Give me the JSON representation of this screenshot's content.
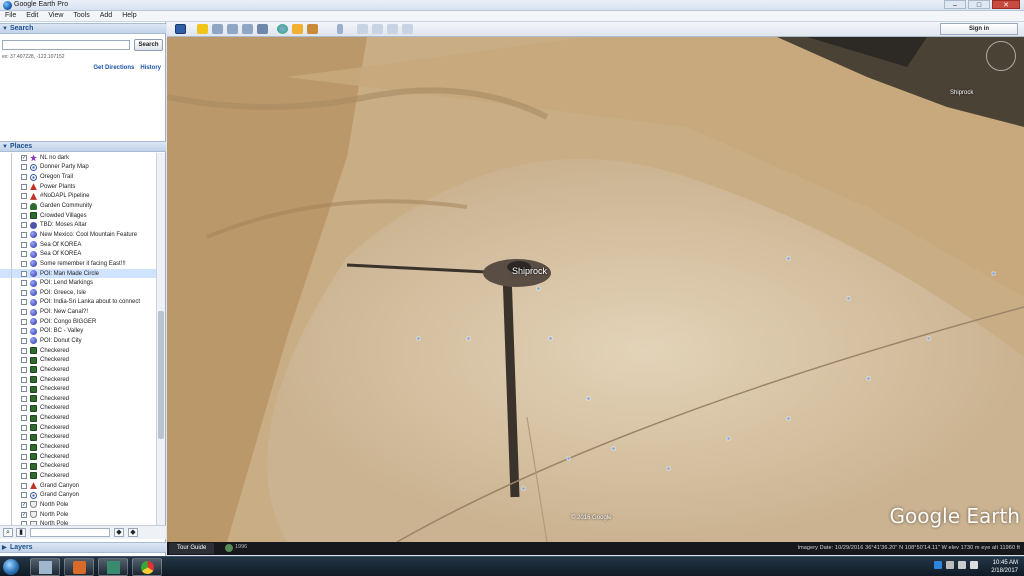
{
  "window": {
    "title": "Google Earth Pro"
  },
  "menu": [
    "File",
    "Edit",
    "View",
    "Tools",
    "Add",
    "Help"
  ],
  "search": {
    "header": "Search",
    "placeholder": "",
    "button": "Search",
    "coords": "ex: 37.407228, -122.107152",
    "get_directions": "Get Directions",
    "history": "History"
  },
  "places": {
    "header": "Places",
    "items": [
      {
        "label": "NL no dark",
        "icon": "star-icon",
        "checked": true
      },
      {
        "label": "Donner Party Map",
        "icon": "network-icon",
        "checked": false
      },
      {
        "label": "Oregon Trail",
        "icon": "network-icon",
        "checked": false
      },
      {
        "label": "Power Plants",
        "icon": "red-triangle-icon",
        "checked": false
      },
      {
        "label": "#NoDAPL Pipeline",
        "icon": "red-triangle-icon",
        "checked": false
      },
      {
        "label": "Garden Community",
        "icon": "tree-icon",
        "checked": false
      },
      {
        "label": "Crowded Villages",
        "icon": "green-square-icon",
        "checked": false
      },
      {
        "label": "TBD: Moses Altar",
        "icon": "folder-icon",
        "checked": false
      },
      {
        "label": "New Mexico: Cool Mountain Feature",
        "icon": "ball-icon",
        "checked": false
      },
      {
        "label": "Sea Of KOREA",
        "icon": "ball-icon",
        "checked": false
      },
      {
        "label": "Sea Of KOREA",
        "icon": "ball-icon",
        "checked": false
      },
      {
        "label": "Some remember it facing East!!!",
        "icon": "ball-icon",
        "checked": false
      },
      {
        "label": "POI: Man Made Circle",
        "icon": "ball-icon",
        "checked": false,
        "selected": true
      },
      {
        "label": "POI: Lend Markings",
        "icon": "ball-icon",
        "checked": false
      },
      {
        "label": "POI: Greece, Isle",
        "icon": "ball-icon",
        "checked": false
      },
      {
        "label": "POI: India-Sri Lanka about to connect",
        "icon": "ball-icon",
        "checked": false
      },
      {
        "label": "POI: New Canal?!",
        "icon": "ball-icon",
        "checked": false
      },
      {
        "label": "POI: Congo BIGGER",
        "icon": "ball-icon",
        "checked": false
      },
      {
        "label": "POI: BC - Valley",
        "icon": "ball-icon",
        "checked": false
      },
      {
        "label": "POI: Donut City",
        "icon": "ball-icon",
        "checked": false
      },
      {
        "label": "Checkered",
        "icon": "green-square-icon",
        "checked": false
      },
      {
        "label": "Checkered",
        "icon": "green-square-icon",
        "checked": false
      },
      {
        "label": "Checkered",
        "icon": "green-square-icon",
        "checked": false
      },
      {
        "label": "Checkered",
        "icon": "green-square-icon",
        "checked": false
      },
      {
        "label": "Checkered",
        "icon": "green-square-icon",
        "checked": false
      },
      {
        "label": "Checkered",
        "icon": "green-square-icon",
        "checked": false
      },
      {
        "label": "Checkered",
        "icon": "green-square-icon",
        "checked": false
      },
      {
        "label": "Checkered",
        "icon": "green-square-icon",
        "checked": false
      },
      {
        "label": "Checkered",
        "icon": "green-square-icon",
        "checked": false
      },
      {
        "label": "Checkered",
        "icon": "green-square-icon",
        "checked": false
      },
      {
        "label": "Checkered",
        "icon": "green-square-icon",
        "checked": false
      },
      {
        "label": "Checkered",
        "icon": "green-square-icon",
        "checked": false
      },
      {
        "label": "Checkered",
        "icon": "green-square-icon",
        "checked": false
      },
      {
        "label": "Checkered",
        "icon": "green-square-icon",
        "checked": false
      },
      {
        "label": "Grand Canyon",
        "icon": "red-triangle-icon",
        "checked": false
      },
      {
        "label": "Grand Canyon",
        "icon": "network-icon",
        "checked": false
      },
      {
        "label": "North Pole",
        "icon": "pole-icon",
        "checked": true
      },
      {
        "label": "North Pole",
        "icon": "pole-icon",
        "checked": true
      },
      {
        "label": "North Pole",
        "icon": "pole-icon",
        "checked": false
      }
    ]
  },
  "layers": {
    "header": "Layers"
  },
  "toolbar": {
    "signin": "Sign in"
  },
  "map": {
    "place_label": "Shiprock",
    "place_label2": "Shiprock",
    "copyright": "© 2016 Google",
    "logo": "Google Earth",
    "tour_guide": "Tour Guide",
    "year": "1996",
    "status": "Imagery Date: 10/29/2016   36°41'36.20\" N  108°50'14.11\" W   elev 1730 m        eye alt 11960 ft"
  },
  "taskbar": {
    "time": "10:45 AM",
    "date": "2/18/2017"
  },
  "colors": {
    "selected_row": "#cfe3ff",
    "link": "#1a55a8",
    "header_text": "#1d4f8c"
  }
}
